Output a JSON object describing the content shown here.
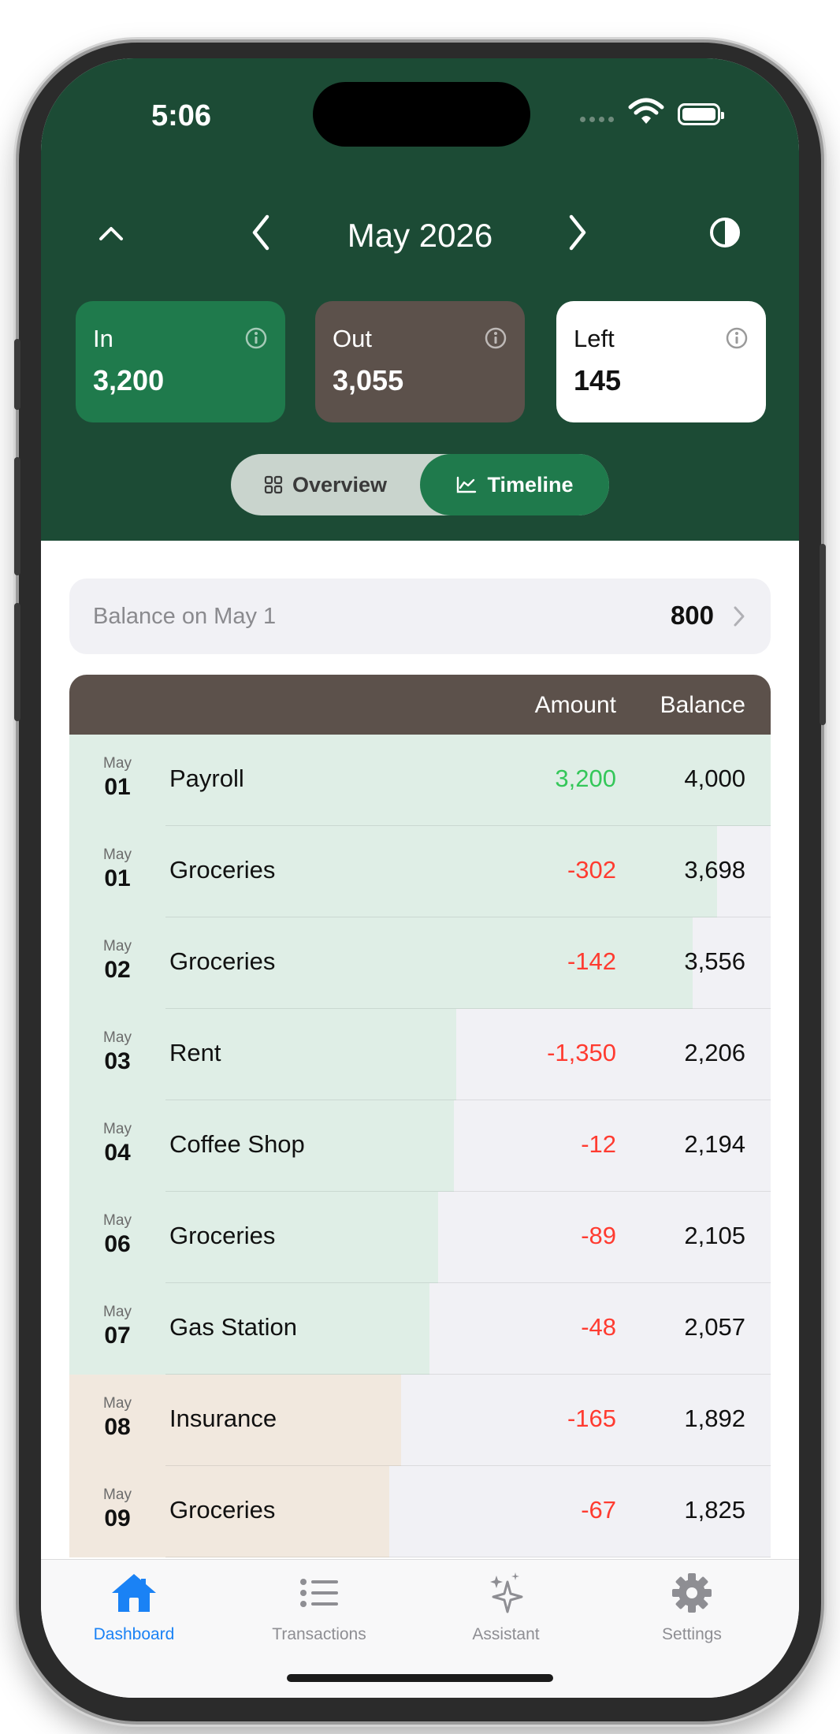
{
  "status": {
    "time": "5:06"
  },
  "header": {
    "month": "May 2026",
    "cards": [
      {
        "label": "In",
        "value": "3,200",
        "color": "#1f7a4c"
      },
      {
        "label": "Out",
        "value": "3,055",
        "color": "#5c514b"
      },
      {
        "label": "Left",
        "value": "145",
        "color": "#ffffff"
      }
    ],
    "segment": {
      "overview": "Overview",
      "timeline": "Timeline",
      "selected": "timeline"
    }
  },
  "balance": {
    "label": "Balance on May 1",
    "value": "800"
  },
  "table": {
    "headers": {
      "amount": "Amount",
      "balance": "Balance"
    },
    "rows": [
      {
        "month": "May",
        "day": "01",
        "name": "Payroll",
        "amount": "3,200",
        "balance": "4,000",
        "level": 1.0,
        "tone": "green",
        "sign": "pos"
      },
      {
        "month": "May",
        "day": "01",
        "name": "Groceries",
        "amount": "-302",
        "balance": "3,698",
        "level": 0.924,
        "tone": "green",
        "sign": "neg"
      },
      {
        "month": "May",
        "day": "02",
        "name": "Groceries",
        "amount": "-142",
        "balance": "3,556",
        "level": 0.889,
        "tone": "green",
        "sign": "neg"
      },
      {
        "month": "May",
        "day": "03",
        "name": "Rent",
        "amount": "-1,350",
        "balance": "2,206",
        "level": 0.552,
        "tone": "green",
        "sign": "neg"
      },
      {
        "month": "May",
        "day": "04",
        "name": "Coffee Shop",
        "amount": "-12",
        "balance": "2,194",
        "level": 0.548,
        "tone": "green",
        "sign": "neg"
      },
      {
        "month": "May",
        "day": "06",
        "name": "Groceries",
        "amount": "-89",
        "balance": "2,105",
        "level": 0.526,
        "tone": "green",
        "sign": "neg"
      },
      {
        "month": "May",
        "day": "07",
        "name": "Gas Station",
        "amount": "-48",
        "balance": "2,057",
        "level": 0.514,
        "tone": "green",
        "sign": "neg"
      },
      {
        "month": "May",
        "day": "08",
        "name": "Insurance",
        "amount": "-165",
        "balance": "1,892",
        "level": 0.473,
        "tone": "beige",
        "sign": "neg"
      },
      {
        "month": "May",
        "day": "09",
        "name": "Groceries",
        "amount": "-67",
        "balance": "1,825",
        "level": 0.456,
        "tone": "beige",
        "sign": "neg"
      }
    ]
  },
  "tabs": [
    {
      "label": "Dashboard",
      "icon": "house-icon",
      "active": true
    },
    {
      "label": "Transactions",
      "icon": "list-icon",
      "active": false
    },
    {
      "label": "Assistant",
      "icon": "sparkles-icon",
      "active": false
    },
    {
      "label": "Settings",
      "icon": "gear-icon",
      "active": false
    }
  ],
  "colors": {
    "header_bg": "#1c4b35",
    "accent": "#1f7a4c",
    "positive": "#34c759",
    "negative": "#ff3b30",
    "tab_active": "#1a82f5",
    "row_green": "#dfeee6",
    "row_beige": "#f1e8de"
  }
}
